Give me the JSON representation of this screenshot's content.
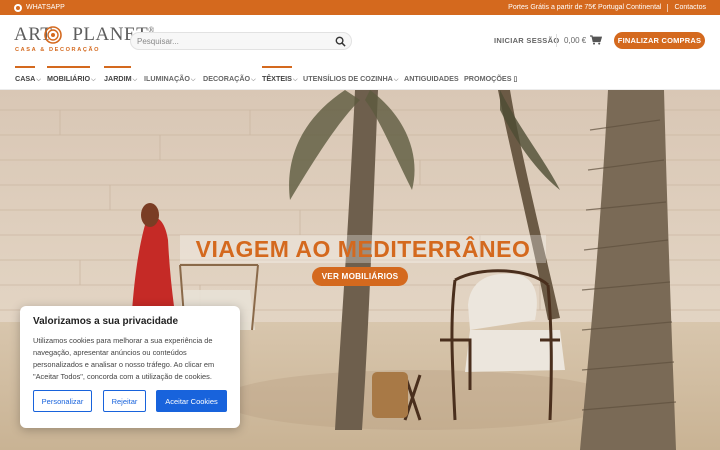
{
  "topbar": {
    "whatsapp": "WHATSAPP",
    "shipping": "Portes Grátis a partir de 75€ Portugal Continental",
    "contacts": "Contactos"
  },
  "logo": {
    "word1": "ART",
    "word2": "PLANET",
    "reg": "®",
    "sub": "CASA & DECORAÇÃO"
  },
  "search": {
    "placeholder": "Pesquisar..."
  },
  "header": {
    "login": "INICIAR SESSÃO",
    "cart_total": "0,00 €",
    "checkout": "FINALIZAR COMPRAS"
  },
  "nav": [
    {
      "label": "CASA",
      "dropdown": true,
      "active": true
    },
    {
      "label": "MOBILIÁRIO",
      "dropdown": true,
      "active": true
    },
    {
      "label": "JARDIM",
      "dropdown": true,
      "active": true
    },
    {
      "label": "ILUMINAÇÃO",
      "dropdown": true,
      "active": false
    },
    {
      "label": "DECORAÇÃO",
      "dropdown": true,
      "active": false
    },
    {
      "label": "TÊXTEIS",
      "dropdown": true,
      "active": true
    },
    {
      "label": "UTENSÍLIOS DE COZINHA",
      "dropdown": true,
      "active": false
    },
    {
      "label": "ANTIGUIDADES",
      "dropdown": false,
      "active": false
    },
    {
      "label": "PROMOÇÕES",
      "dropdown": false,
      "active": false,
      "suffix": "▯"
    }
  ],
  "hero": {
    "title": "VIAGEM AO MEDITERRÂNEO",
    "button": "VER MOBILIÁRIOS"
  },
  "cookie": {
    "title": "Valorizamos a sua privacidade",
    "text": "Utilizamos cookies para melhorar a sua experiência de navegação, apresentar anúncios ou conteúdos personalizados e analisar o nosso tráfego. Ao clicar em \"Aceitar Todos\", concorda com a utilização de cookies.",
    "customize": "Personalizar",
    "reject": "Rejeitar",
    "accept": "Aceitar Cookies"
  },
  "colors": {
    "accent": "#d4691e",
    "cookie_blue": "#1863dc"
  }
}
